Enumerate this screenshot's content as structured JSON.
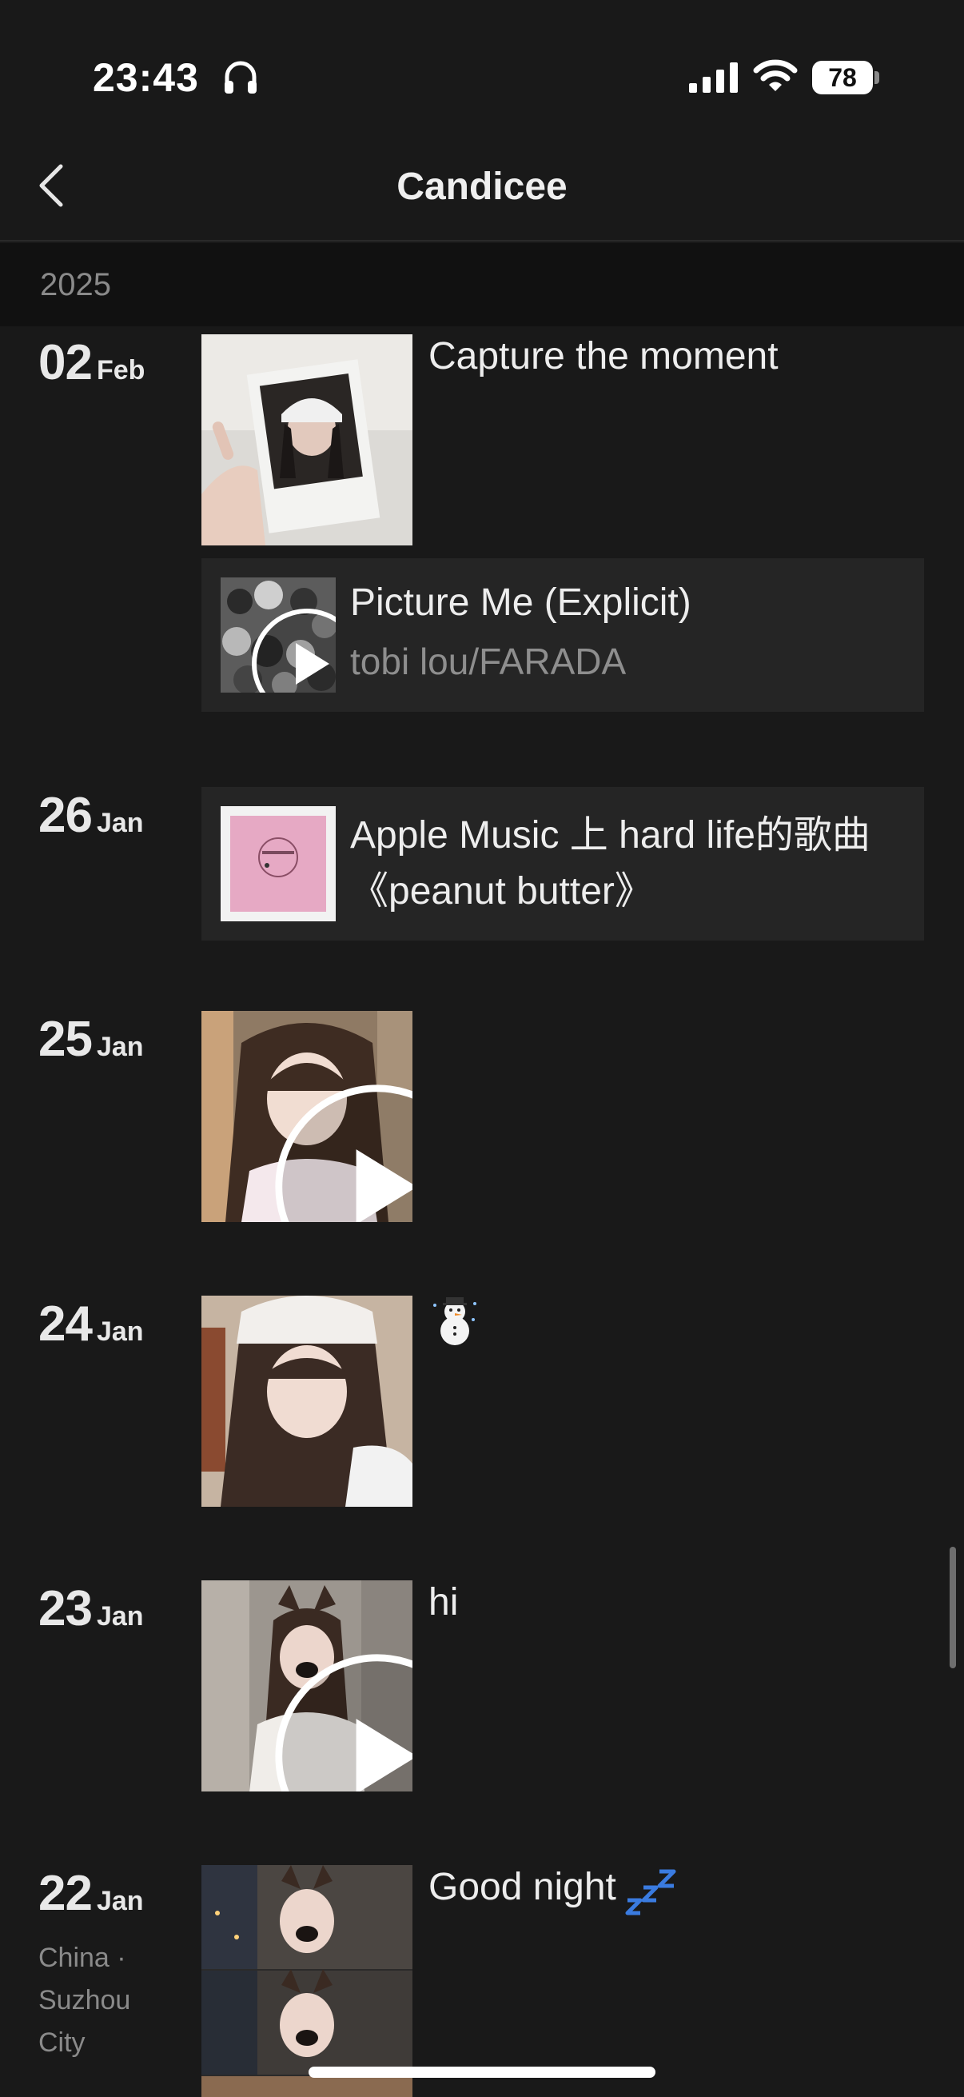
{
  "status_bar": {
    "time": "23:43",
    "battery": "78"
  },
  "nav": {
    "title": "Candicee"
  },
  "year": "2025",
  "entries": [
    {
      "day": "02",
      "month": "Feb",
      "caption": "Capture the moment",
      "music": {
        "title": "Picture Me (Explicit)",
        "artist": "tobi lou/FARADA"
      }
    },
    {
      "day": "26",
      "month": "Jan",
      "music": {
        "text": "Apple Music 上 hard life的歌曲《peanut butter》"
      }
    },
    {
      "day": "25",
      "month": "Jan"
    },
    {
      "day": "24",
      "month": "Jan",
      "emoji": "snowman-icon"
    },
    {
      "day": "23",
      "month": "Jan",
      "caption": "hi"
    },
    {
      "day": "22",
      "month": "Jan",
      "caption": "Good night",
      "caption_icon": "zzz-icon",
      "location": "China · Suzhou City"
    }
  ],
  "colors": {
    "background": "#191919",
    "year_band": "#111111",
    "card": "#252525",
    "secondary_text": "#8a8a8a"
  }
}
